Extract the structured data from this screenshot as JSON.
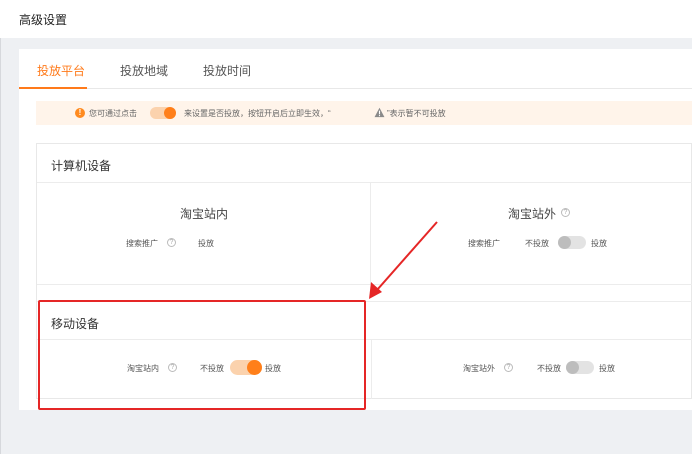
{
  "header": {
    "title": "高级设置"
  },
  "tabs": [
    {
      "label": "投放平台",
      "active": true
    },
    {
      "label": "投放地域",
      "active": false
    },
    {
      "label": "投放时间",
      "active": false
    }
  ],
  "notice": {
    "part1": "您可通过点击",
    "part2": "来设置是否投放，按钮开启后立即生效，“",
    "part3": "”表示暂不可投放"
  },
  "computer": {
    "title": "计算机设备",
    "taobao_in": {
      "title": "淘宝站内",
      "row_label": "搜索推广",
      "value": "投放"
    },
    "taobao_out": {
      "title": "淘宝站外",
      "row_label": "搜索推广",
      "off_label": "不投放",
      "on_label": "投放",
      "toggle": "off"
    }
  },
  "mobile": {
    "title": "移动设备",
    "taobao_in": {
      "label": "淘宝站内",
      "off_label": "不投放",
      "on_label": "投放",
      "toggle": "on"
    },
    "taobao_out": {
      "label": "淘宝站外",
      "off_label": "不投放",
      "on_label": "投放",
      "toggle": "off"
    }
  },
  "colors": {
    "accent": "#ff7a1a",
    "annotation": "#e52626"
  }
}
